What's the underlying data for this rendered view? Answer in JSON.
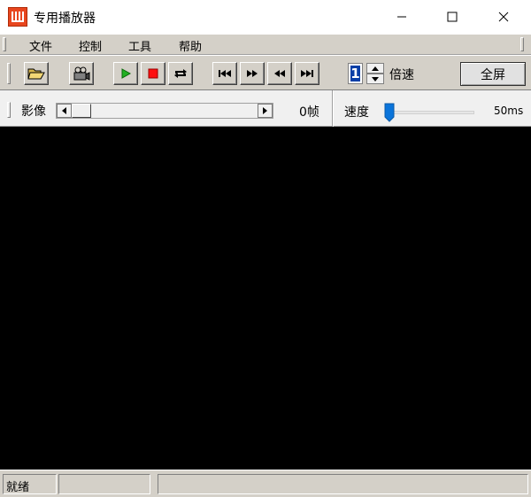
{
  "window": {
    "title": "专用播放器",
    "brand_color": "#e8461e"
  },
  "menu": {
    "items": [
      "文件",
      "控制",
      "工具",
      "帮助"
    ]
  },
  "toolbar": {
    "buttons": [
      {
        "icon": "open-folder-icon"
      },
      {
        "icon": "camera-icon"
      },
      {
        "icon": "play-icon"
      },
      {
        "icon": "stop-icon"
      },
      {
        "icon": "repeat-icon"
      },
      {
        "icon": "skip-to-start-icon"
      },
      {
        "icon": "fast-forward-icon"
      },
      {
        "icon": "rewind-icon"
      },
      {
        "icon": "skip-to-end-icon"
      }
    ],
    "speed_multiplier": "1",
    "speed_multiplier_label": "倍速",
    "fullscreen_label": "全屏"
  },
  "sliders": {
    "image_label": "影像",
    "frame_count": "0帧",
    "speed_label": "速度",
    "speed_value": "50ms",
    "image_position_fraction": 0,
    "speed_fraction": 0
  },
  "status": {
    "ready": "就绪",
    "pane2": "",
    "pane3": ""
  }
}
